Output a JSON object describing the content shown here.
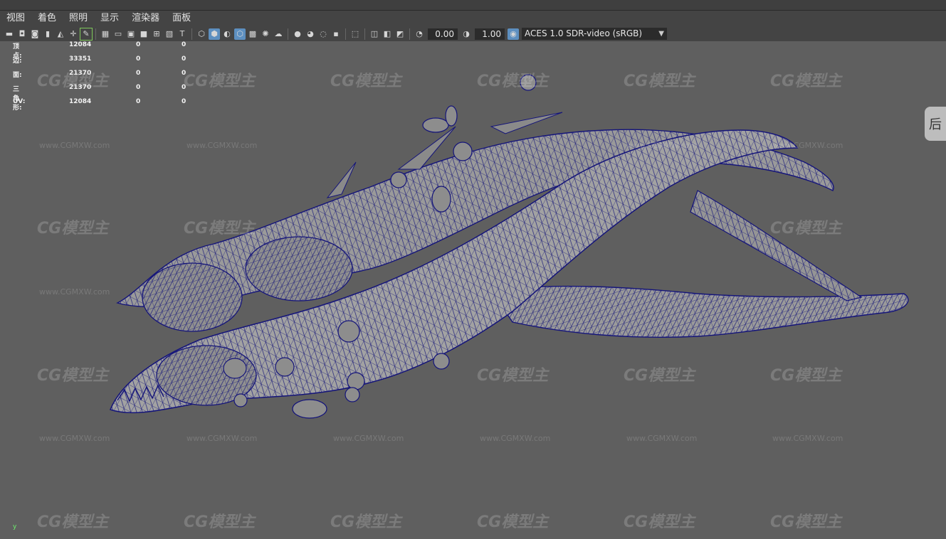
{
  "menu": [
    "视图",
    "着色",
    "照明",
    "显示",
    "渲染器",
    "面板"
  ],
  "toolbar": {
    "exposure": "0.00",
    "gamma": "1.00",
    "color_space": "ACES 1.0 SDR-video (sRGB)"
  },
  "hud": {
    "rows": [
      {
        "label": "顶点:",
        "v1": "12084",
        "v2": "0",
        "v3": "0"
      },
      {
        "label": "边:",
        "v1": "33351",
        "v2": "0",
        "v3": "0"
      },
      {
        "label": "面:",
        "v1": "21370",
        "v2": "0",
        "v3": "0"
      },
      {
        "label": "三角形:",
        "v1": "21370",
        "v2": "0",
        "v3": "0"
      },
      {
        "label": "UV:",
        "v1": "12084",
        "v2": "0",
        "v3": "0"
      }
    ]
  },
  "watermark": {
    "logo": "CG模型主",
    "url": "www.CGMXW.com"
  },
  "side_handle": "后",
  "axis": "y"
}
